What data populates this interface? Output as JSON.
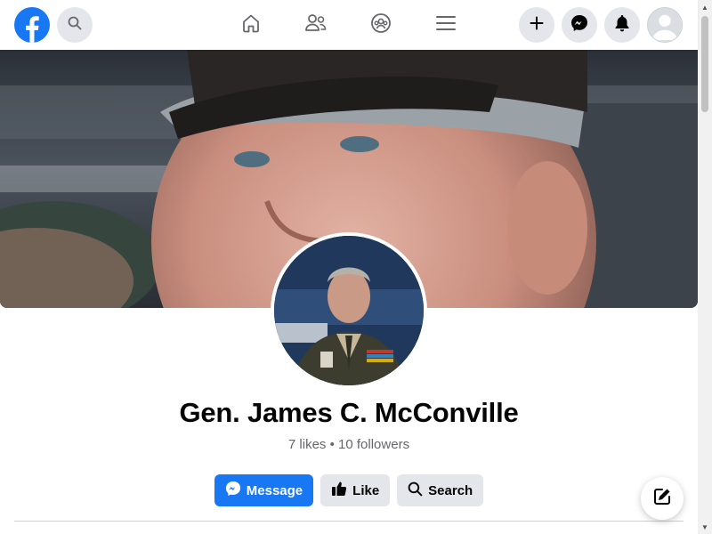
{
  "nav": {
    "logo_icon": "facebook-logo-icon",
    "search_icon": "search-icon",
    "home_icon": "home-icon",
    "friends_icon": "friends-icon",
    "groups_icon": "groups-icon",
    "menu_icon": "hamburger-menu-icon",
    "create_icon": "plus-icon",
    "messenger_icon": "messenger-icon",
    "notifications_icon": "bell-icon",
    "account_icon": "account-avatar-icon"
  },
  "profile": {
    "name": "Gen. James C. McConville",
    "likes": "7 likes",
    "separator": " • ",
    "followers": "10 followers"
  },
  "actions": {
    "message_label": "Message",
    "like_label": "Like",
    "search_label": "Search"
  },
  "fab_icon": "compose-icon",
  "colors": {
    "brand": "#1877f2",
    "secondary_button": "#e4e6eb",
    "text_primary": "#050505",
    "text_secondary": "#65676b"
  }
}
